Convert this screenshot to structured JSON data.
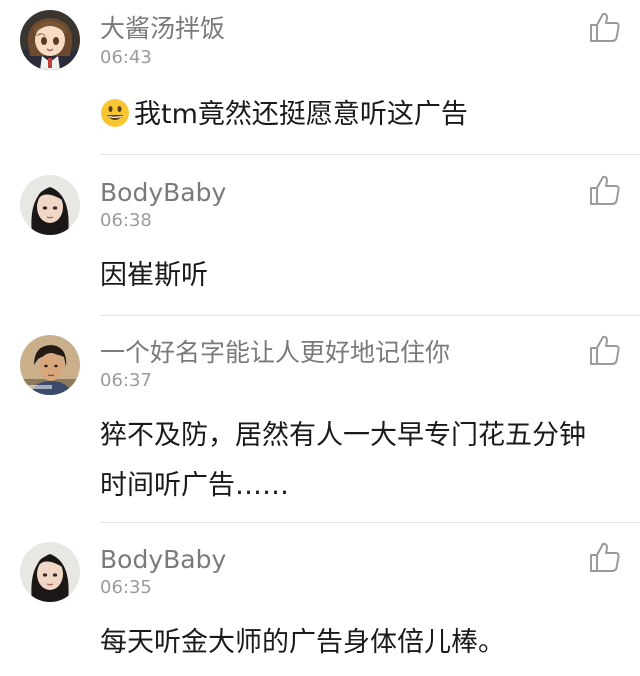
{
  "comments": [
    {
      "name": "大酱汤拌饭",
      "time": "06:43",
      "text": "我tm竟然还挺愿意听这广告",
      "has_emoji": true,
      "emoji_icon": "grinning-face-emoji"
    },
    {
      "name": "BodyBaby",
      "time": "06:38",
      "text": "因崔斯听"
    },
    {
      "name": "一个好名字能让人更好地记住你",
      "time": "06:37",
      "text_line1": "猝不及防，居然有人一大早专门花五分钟",
      "text_line2": "时间听广告……"
    },
    {
      "name": "BodyBaby",
      "time": "06:35",
      "text": "每天听金大师的广告身体倍儿棒。"
    }
  ],
  "icons": {
    "like": "thumbs-up-icon"
  },
  "colors": {
    "name": "#7a7a7a",
    "time": "#9b9b9b",
    "text": "#1a1a1a",
    "divider": "#e3e3e3",
    "icon": "#9a9a9a"
  }
}
